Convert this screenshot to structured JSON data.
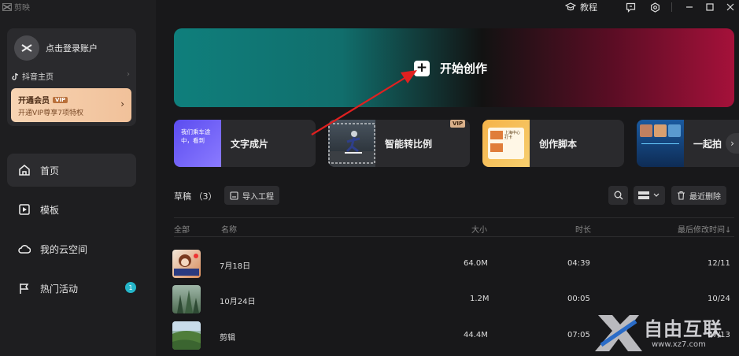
{
  "app": {
    "title": "剪映"
  },
  "topbar": {
    "tutorial_label": "教程"
  },
  "sidebar": {
    "login_label": "点击登录账户",
    "douyin_label": "抖音主页",
    "vip": {
      "title": "开通会员",
      "badge": "VIP",
      "subtitle": "开通VIP尊享7项特权"
    },
    "nav": [
      {
        "label": "首页",
        "icon": "home-icon"
      },
      {
        "label": "模板",
        "icon": "template-icon"
      },
      {
        "label": "我的云空间",
        "icon": "cloud-icon"
      },
      {
        "label": "热门活动",
        "icon": "flag-icon",
        "badge": "1"
      }
    ]
  },
  "main": {
    "start_label": "开始创作",
    "tools": [
      {
        "label": "文字成片",
        "thumb_text": "我们乘车途中，看到"
      },
      {
        "label": "智能转比例",
        "badge": "VIP"
      },
      {
        "label": "创作脚本",
        "thumb_text": "上海中心打卡"
      },
      {
        "label": "一起拍"
      }
    ],
    "drafts": {
      "title": "草稿 （3）",
      "import_label": "导入工程",
      "recent_delete_label": "最近删除",
      "columns": {
        "all": "全部",
        "name": "名称",
        "size": "大小",
        "duration": "时长",
        "modified": "最后修改时间↓"
      },
      "rows": [
        {
          "name": "7月18日",
          "size": "64.0M",
          "duration": "04:39",
          "modified": "12/11"
        },
        {
          "name": "10月24日",
          "size": "1.2M",
          "duration": "00:05",
          "modified": "10/24"
        },
        {
          "name": "剪辑",
          "size": "44.4M",
          "duration": "07:05",
          "modified": "07/13"
        }
      ]
    }
  },
  "watermark": {
    "text": "自由互联",
    "url": "www.xz7.com"
  },
  "colors": {
    "accent_teal": "#25b6c9",
    "annotation_red": "#e02020",
    "vip_gold": "#f1c19a"
  }
}
